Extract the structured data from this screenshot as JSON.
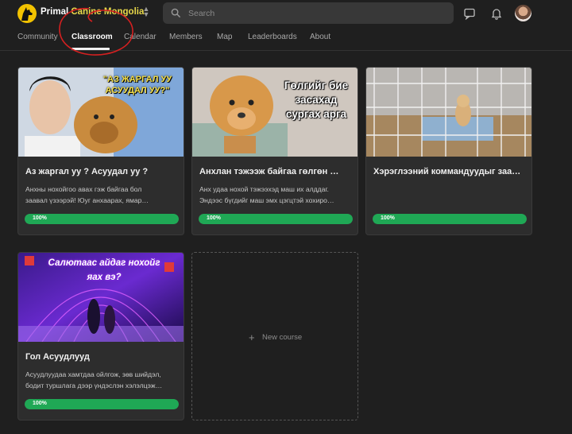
{
  "header": {
    "group_name_part1": "Primal ",
    "group_name_part2": "Canine Mongolia",
    "group_name_part2_color": "#e8d84a",
    "search_placeholder": "Search",
    "icons": [
      "switcher-chevron-icon",
      "search-icon",
      "chat-icon",
      "bell-icon"
    ]
  },
  "nav": {
    "tabs": [
      {
        "label": "Community"
      },
      {
        "label": "Classroom",
        "active": true
      },
      {
        "label": "Calendar"
      },
      {
        "label": "Members"
      },
      {
        "label": "Map"
      },
      {
        "label": "Leaderboards"
      },
      {
        "label": "About"
      }
    ]
  },
  "courses": [
    {
      "thumb_caption_line1": "\"АЗ ЖАРГАЛ УУ",
      "thumb_caption_line2": "АСУУДАЛ УУ?\"",
      "title": "Аз жаргал уу ? Асуудал уу ?",
      "desc_line1": "Анхны нохойгоо авах гэж байгаа бол",
      "desc_line2": "заавал үзээрэй! Юуг анхаарах, ямар…",
      "progress_label": "100%",
      "progress": 1.0
    },
    {
      "thumb_caption_line1": "Гөлгийг бие",
      "thumb_caption_line2": "засахад",
      "thumb_caption_line3": "сургах арга",
      "title": "Анхлан тэжээж байгаа гөлгөн …",
      "desc_line1": "Анх удаа нохой тэжээхэд маш их алддаг.",
      "desc_line2": "Эндээс бүгдийг маш эмх цэгцтэй хохиро…",
      "progress_label": "100%",
      "progress": 1.0
    },
    {
      "title": "Хэрэглээний коммандуудыг заа…",
      "progress_label": "100%",
      "progress": 1.0
    },
    {
      "thumb_caption_line1": "Салютаас айдаг нохойг",
      "thumb_caption_line2": "яах вэ?",
      "title": "Гол Асуудлууд",
      "desc_line1": "Асуудлуудаа хамтдаа ойлгож, зөв шийдэл,",
      "desc_line2": "бодит туршлага дээр үндэслэн хэлэлцэж…",
      "progress_label": "100%",
      "progress": 1.0
    }
  ],
  "new_course": {
    "plus": "+",
    "label": "New course"
  },
  "colors": {
    "background": "#1f1f1f",
    "card": "#2d2d2d",
    "progress": "#1fa855",
    "annotation": "#d42020"
  }
}
